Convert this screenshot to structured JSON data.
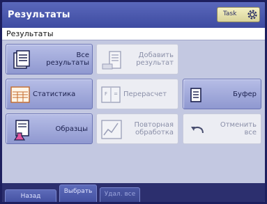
{
  "header": {
    "title": "Результаты",
    "task_label": "Task"
  },
  "subheader": {
    "title": "Результаты"
  },
  "buttons": {
    "all_results": "Все результаты",
    "add_result": "Добавить результат",
    "statistics": "Статистика",
    "recalculate": "Перерасчет",
    "buffer": "Буфер",
    "samples": "Образцы",
    "reprocess": "Повторная обработка",
    "undo_all": "Отменить все"
  },
  "bottom_bar": {
    "back": "Назад",
    "select": "Выбрать",
    "delete_all": "Удал. все"
  },
  "colors": {
    "accent": "#4552a3",
    "button_active": "#9aa2d6",
    "button_disabled": "#ecedf3"
  }
}
